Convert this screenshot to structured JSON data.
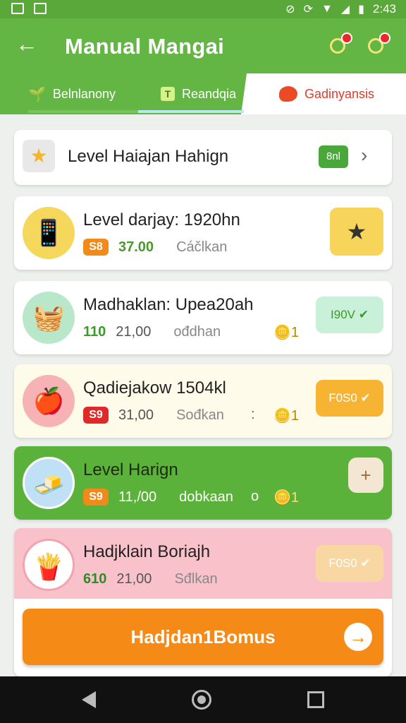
{
  "status_bar": {
    "time": "2:43"
  },
  "app_bar": {
    "back": "←",
    "title": "Manual Mangai"
  },
  "tabs": [
    {
      "label": "Belnlanony",
      "icon": "sprout-icon"
    },
    {
      "label": "Reandqia",
      "icon": "ticket-icon"
    },
    {
      "label": "Gadinyansis",
      "icon": "speech-bubble-icon"
    }
  ],
  "summary": {
    "title": "Level Haiajan Hahign",
    "pill": "8nl",
    "chevron": "›"
  },
  "levels": [
    {
      "name": "Level darjay: 1920hn",
      "badge": "S8",
      "amount": "37.00",
      "sub": "Cáčlkan",
      "coin": "",
      "button": "★"
    },
    {
      "name": "Madhaklan: Upea20ah",
      "badge": "110",
      "amount": "21,00",
      "sub": "ođdhan",
      "coin": "1",
      "button": "I90V ✔"
    },
    {
      "name": "Qadiejakow 1504kl",
      "badge": "S9",
      "amount": "31,00",
      "sub": "Sođkan",
      "dot": ":",
      "coin": "1",
      "button": "F0S0 ✔"
    },
    {
      "name": "Level Harign",
      "badge": "S9",
      "amount": "11,/00",
      "sub": "dobkaan",
      "dot": "o",
      "coin": "1",
      "button": "+"
    },
    {
      "name": "Hadjklain Boriajh",
      "badge": "610",
      "amount": "21,00",
      "sub": "Sđlkan",
      "coin": "",
      "button": "F0S0 ✔"
    }
  ],
  "cta": {
    "label": "Hadjdan1Bomus",
    "arrow": "→"
  },
  "colors": {
    "primary_green": "#63b544",
    "orange": "#f58a16",
    "red": "#e43a2a"
  }
}
